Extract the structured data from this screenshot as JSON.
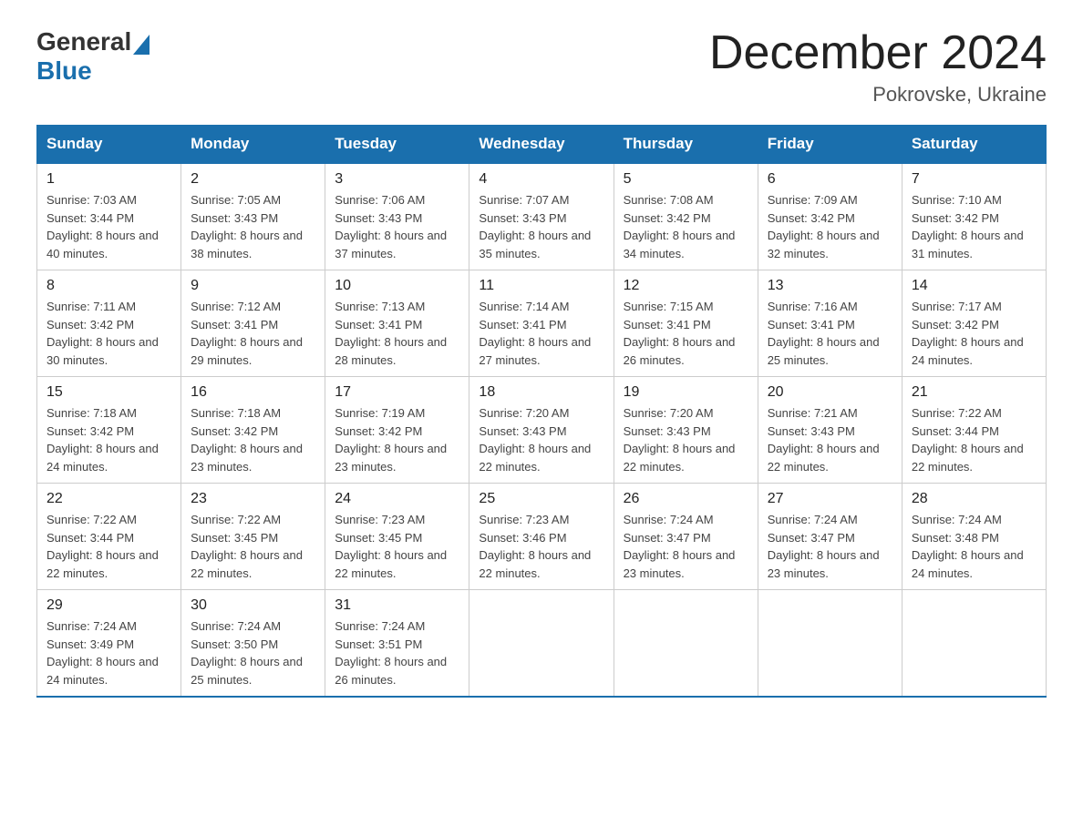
{
  "logo": {
    "general": "General",
    "blue": "Blue"
  },
  "title": {
    "month_year": "December 2024",
    "location": "Pokrovske, Ukraine"
  },
  "days_of_week": [
    "Sunday",
    "Monday",
    "Tuesday",
    "Wednesday",
    "Thursday",
    "Friday",
    "Saturday"
  ],
  "weeks": [
    [
      {
        "day": "1",
        "sunrise": "7:03 AM",
        "sunset": "3:44 PM",
        "daylight": "8 hours and 40 minutes."
      },
      {
        "day": "2",
        "sunrise": "7:05 AM",
        "sunset": "3:43 PM",
        "daylight": "8 hours and 38 minutes."
      },
      {
        "day": "3",
        "sunrise": "7:06 AM",
        "sunset": "3:43 PM",
        "daylight": "8 hours and 37 minutes."
      },
      {
        "day": "4",
        "sunrise": "7:07 AM",
        "sunset": "3:43 PM",
        "daylight": "8 hours and 35 minutes."
      },
      {
        "day": "5",
        "sunrise": "7:08 AM",
        "sunset": "3:42 PM",
        "daylight": "8 hours and 34 minutes."
      },
      {
        "day": "6",
        "sunrise": "7:09 AM",
        "sunset": "3:42 PM",
        "daylight": "8 hours and 32 minutes."
      },
      {
        "day": "7",
        "sunrise": "7:10 AM",
        "sunset": "3:42 PM",
        "daylight": "8 hours and 31 minutes."
      }
    ],
    [
      {
        "day": "8",
        "sunrise": "7:11 AM",
        "sunset": "3:42 PM",
        "daylight": "8 hours and 30 minutes."
      },
      {
        "day": "9",
        "sunrise": "7:12 AM",
        "sunset": "3:41 PM",
        "daylight": "8 hours and 29 minutes."
      },
      {
        "day": "10",
        "sunrise": "7:13 AM",
        "sunset": "3:41 PM",
        "daylight": "8 hours and 28 minutes."
      },
      {
        "day": "11",
        "sunrise": "7:14 AM",
        "sunset": "3:41 PM",
        "daylight": "8 hours and 27 minutes."
      },
      {
        "day": "12",
        "sunrise": "7:15 AM",
        "sunset": "3:41 PM",
        "daylight": "8 hours and 26 minutes."
      },
      {
        "day": "13",
        "sunrise": "7:16 AM",
        "sunset": "3:41 PM",
        "daylight": "8 hours and 25 minutes."
      },
      {
        "day": "14",
        "sunrise": "7:17 AM",
        "sunset": "3:42 PM",
        "daylight": "8 hours and 24 minutes."
      }
    ],
    [
      {
        "day": "15",
        "sunrise": "7:18 AM",
        "sunset": "3:42 PM",
        "daylight": "8 hours and 24 minutes."
      },
      {
        "day": "16",
        "sunrise": "7:18 AM",
        "sunset": "3:42 PM",
        "daylight": "8 hours and 23 minutes."
      },
      {
        "day": "17",
        "sunrise": "7:19 AM",
        "sunset": "3:42 PM",
        "daylight": "8 hours and 23 minutes."
      },
      {
        "day": "18",
        "sunrise": "7:20 AM",
        "sunset": "3:43 PM",
        "daylight": "8 hours and 22 minutes."
      },
      {
        "day": "19",
        "sunrise": "7:20 AM",
        "sunset": "3:43 PM",
        "daylight": "8 hours and 22 minutes."
      },
      {
        "day": "20",
        "sunrise": "7:21 AM",
        "sunset": "3:43 PM",
        "daylight": "8 hours and 22 minutes."
      },
      {
        "day": "21",
        "sunrise": "7:22 AM",
        "sunset": "3:44 PM",
        "daylight": "8 hours and 22 minutes."
      }
    ],
    [
      {
        "day": "22",
        "sunrise": "7:22 AM",
        "sunset": "3:44 PM",
        "daylight": "8 hours and 22 minutes."
      },
      {
        "day": "23",
        "sunrise": "7:22 AM",
        "sunset": "3:45 PM",
        "daylight": "8 hours and 22 minutes."
      },
      {
        "day": "24",
        "sunrise": "7:23 AM",
        "sunset": "3:45 PM",
        "daylight": "8 hours and 22 minutes."
      },
      {
        "day": "25",
        "sunrise": "7:23 AM",
        "sunset": "3:46 PM",
        "daylight": "8 hours and 22 minutes."
      },
      {
        "day": "26",
        "sunrise": "7:24 AM",
        "sunset": "3:47 PM",
        "daylight": "8 hours and 23 minutes."
      },
      {
        "day": "27",
        "sunrise": "7:24 AM",
        "sunset": "3:47 PM",
        "daylight": "8 hours and 23 minutes."
      },
      {
        "day": "28",
        "sunrise": "7:24 AM",
        "sunset": "3:48 PM",
        "daylight": "8 hours and 24 minutes."
      }
    ],
    [
      {
        "day": "29",
        "sunrise": "7:24 AM",
        "sunset": "3:49 PM",
        "daylight": "8 hours and 24 minutes."
      },
      {
        "day": "30",
        "sunrise": "7:24 AM",
        "sunset": "3:50 PM",
        "daylight": "8 hours and 25 minutes."
      },
      {
        "day": "31",
        "sunrise": "7:24 AM",
        "sunset": "3:51 PM",
        "daylight": "8 hours and 26 minutes."
      },
      null,
      null,
      null,
      null
    ]
  ]
}
